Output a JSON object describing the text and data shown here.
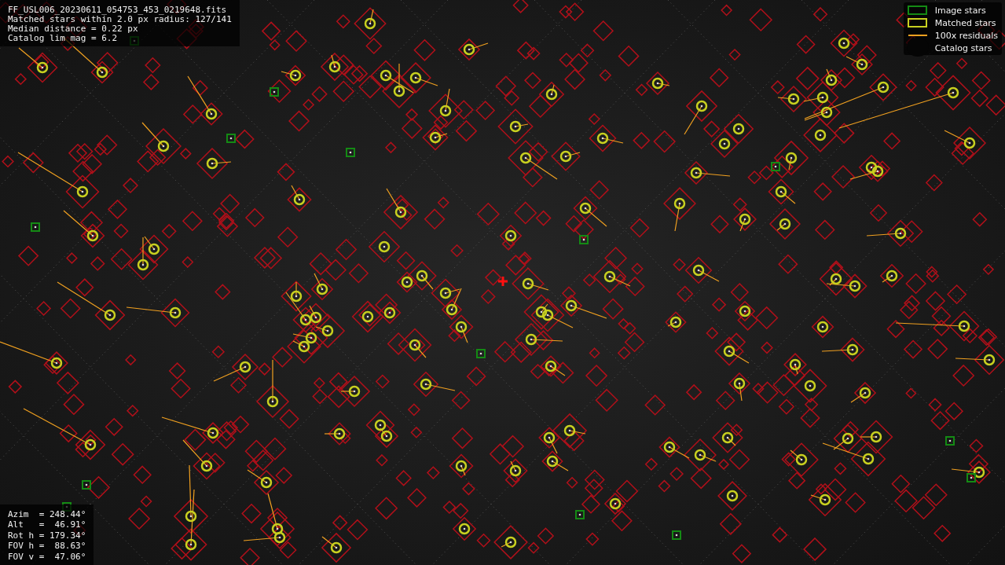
{
  "header": {
    "lines": [
      "FF_USL006_20230611_054753_453_0219648.fits",
      "Matched stars within 2.0 px radius: 127/141",
      "Median distance = 0.22 px",
      "Catalog lim mag = 6.2"
    ]
  },
  "legend": {
    "items": [
      {
        "kind": "image",
        "label": "Image stars"
      },
      {
        "kind": "matched",
        "label": "Matched stars"
      },
      {
        "kind": "residual",
        "label": "100x residuals"
      },
      {
        "kind": "catalog",
        "label": "Catalog stars"
      }
    ]
  },
  "pointing": {
    "lines": [
      "Azim  = 248.44°",
      "Alt   =  46.91°",
      "Rot h = 179.34°",
      "FOV h =  88.63°",
      "FOV v =  47.06°"
    ]
  }
}
